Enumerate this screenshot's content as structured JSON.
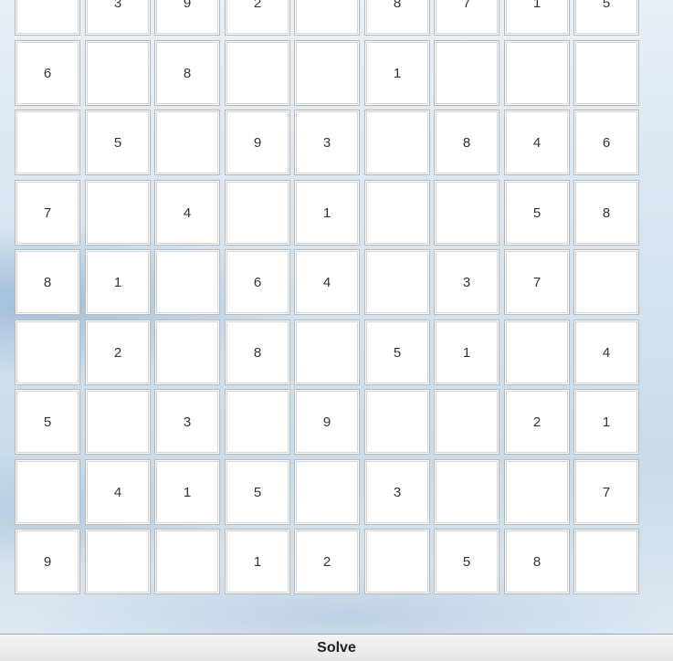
{
  "grid": [
    [
      "",
      "3",
      "9",
      "2",
      "",
      "8",
      "7",
      "1",
      "5"
    ],
    [
      "6",
      "",
      "8",
      "",
      "",
      "1",
      "",
      "",
      ""
    ],
    [
      "",
      "5",
      "",
      "9",
      "3",
      "",
      "8",
      "4",
      "6"
    ],
    [
      "7",
      "",
      "4",
      "",
      "1",
      "",
      "",
      "5",
      "8"
    ],
    [
      "8",
      "1",
      "",
      "6",
      "4",
      "",
      "3",
      "7",
      ""
    ],
    [
      "",
      "2",
      "",
      "8",
      "",
      "5",
      "1",
      "",
      "4"
    ],
    [
      "5",
      "",
      "3",
      "",
      "9",
      "",
      "",
      "2",
      "1"
    ],
    [
      "",
      "4",
      "1",
      "5",
      "",
      "3",
      "",
      "",
      "7"
    ],
    [
      "9",
      "",
      "",
      "1",
      "2",
      "",
      "5",
      "8",
      ""
    ]
  ],
  "solve_button": {
    "label": "Solve"
  }
}
